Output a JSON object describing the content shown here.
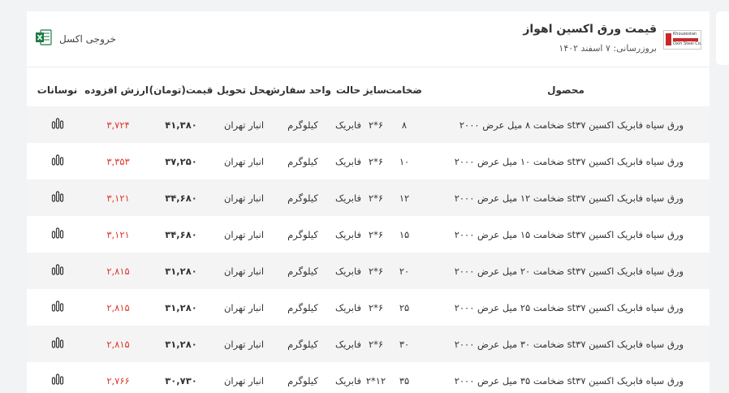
{
  "header": {
    "title": "قیمت ورق اکسین اهواز",
    "updated": "بروزرسانی: ۷ اسفند ۱۴۰۲",
    "excel_label": "خروجی اکسل",
    "logo_text_top": "Khouzestan",
    "logo_text_bottom": "Oxin Steel Co."
  },
  "columns": {
    "product": "محصول",
    "thickness": "ضخامت",
    "size": "سایز",
    "state": "حالت",
    "unit": "واحد سفارش",
    "delivery": "محل تحویل",
    "price": "قیمت(تومان)",
    "vat": "ارزش افزوده",
    "fluctuation": "نوسانات"
  },
  "rows": [
    {
      "product": "ورق سیاه فابریک اکسین st۳۷ ضخامت ۸ میل عرض ۲۰۰۰",
      "thickness": "۸",
      "size": "۶*۲",
      "state": "فابریک",
      "unit": "کیلوگرم",
      "delivery": "انبار تهران",
      "price": "۴۱,۳۸۰",
      "vat": "۳,۷۲۴"
    },
    {
      "product": "ورق سیاه فابریک اکسین st۳۷ ضخامت ۱۰ میل عرض ۲۰۰۰",
      "thickness": "۱۰",
      "size": "۶*۲",
      "state": "فابریک",
      "unit": "کیلوگرم",
      "delivery": "انبار تهران",
      "price": "۳۷,۲۵۰",
      "vat": "۳,۳۵۳"
    },
    {
      "product": "ورق سیاه فابریک اکسین st۳۷ ضخامت ۱۲ میل عرض ۲۰۰۰",
      "thickness": "۱۲",
      "size": "۶*۲",
      "state": "فابریک",
      "unit": "کیلوگرم",
      "delivery": "انبار تهران",
      "price": "۳۴,۶۸۰",
      "vat": "۳,۱۲۱"
    },
    {
      "product": "ورق سیاه فابریک اکسین st۳۷ ضخامت ۱۵ میل عرض ۲۰۰۰",
      "thickness": "۱۵",
      "size": "۶*۲",
      "state": "فابریک",
      "unit": "کیلوگرم",
      "delivery": "انبار تهران",
      "price": "۳۴,۶۸۰",
      "vat": "۳,۱۲۱"
    },
    {
      "product": "ورق سیاه فابریک اکسین st۳۷ ضخامت ۲۰ میل عرض ۲۰۰۰",
      "thickness": "۲۰",
      "size": "۶*۲",
      "state": "فابریک",
      "unit": "کیلوگرم",
      "delivery": "انبار تهران",
      "price": "۳۱,۲۸۰",
      "vat": "۲,۸۱۵"
    },
    {
      "product": "ورق سیاه فابریک اکسین st۳۷ ضخامت ۲۵ میل عرض ۲۰۰۰",
      "thickness": "۲۵",
      "size": "۶*۲",
      "state": "فابریک",
      "unit": "کیلوگرم",
      "delivery": "انبار تهران",
      "price": "۳۱,۲۸۰",
      "vat": "۲,۸۱۵"
    },
    {
      "product": "ورق سیاه فابریک اکسین st۳۷ ضخامت ۳۰ میل عرض ۲۰۰۰",
      "thickness": "۳۰",
      "size": "۶*۲",
      "state": "فابریک",
      "unit": "کیلوگرم",
      "delivery": "انبار تهران",
      "price": "۳۱,۲۸۰",
      "vat": "۲,۸۱۵"
    },
    {
      "product": "ورق سیاه فابریک اکسین st۳۷ ضخامت ۳۵ میل عرض ۲۰۰۰",
      "thickness": "۳۵",
      "size": "۱۲*۲",
      "state": "فابریک",
      "unit": "کیلوگرم",
      "delivery": "انبار تهران",
      "price": "۳۰,۷۳۰",
      "vat": "۲,۷۶۶"
    }
  ],
  "icons": {
    "fluctuation": "bar-chart-icon",
    "excel": "excel-file-icon"
  },
  "colors": {
    "vat": "#e0362c",
    "excel": "#1d7a45",
    "logo": "#c9272d"
  }
}
